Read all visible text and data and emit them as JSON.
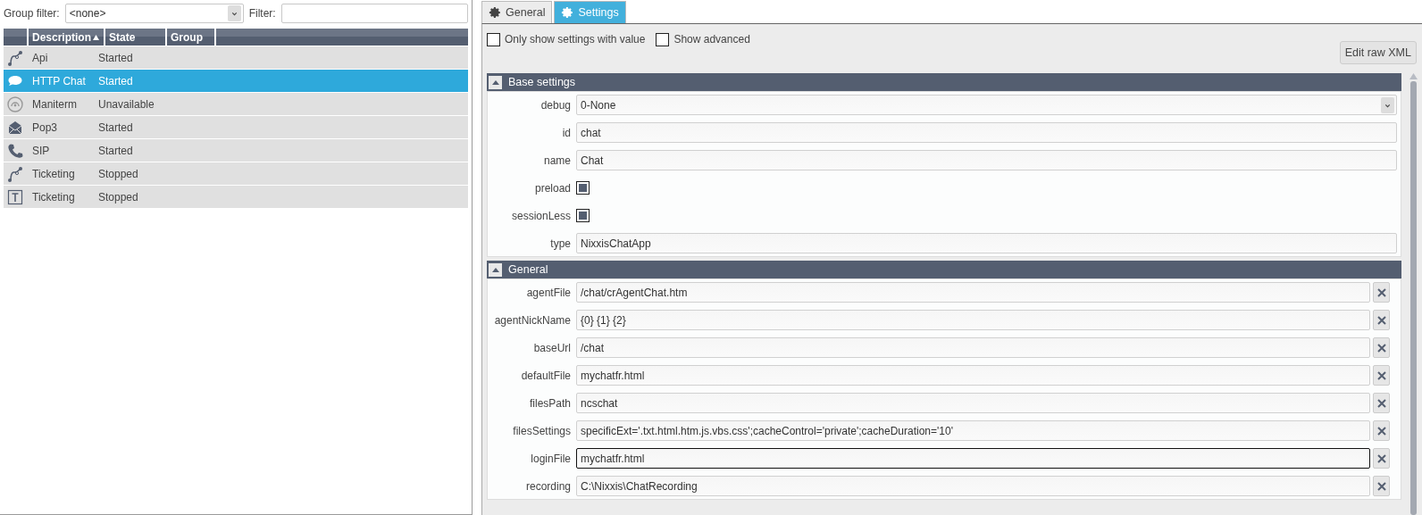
{
  "left": {
    "group_filter": {
      "label": "Group filter:",
      "value": "<none>"
    },
    "filter": {
      "label": "Filter:"
    },
    "columns": [
      {
        "sorted": false
      },
      {
        "label": "Description",
        "sorted": true
      },
      {
        "label": "State",
        "sorted": false
      },
      {
        "label": "Group",
        "sorted": false
      }
    ],
    "rows": [
      {
        "kind": "route",
        "description": "Api",
        "state": "Started",
        "selected": false
      },
      {
        "kind": "chat",
        "description": "HTTP Chat",
        "state": "Started",
        "selected": true
      },
      {
        "kind": "gauge",
        "description": "Maniterm",
        "state": "Unavailable",
        "selected": false
      },
      {
        "kind": "mail",
        "description": "Pop3",
        "state": "Started",
        "selected": false
      },
      {
        "kind": "phone",
        "description": "SIP",
        "state": "Started",
        "selected": false
      },
      {
        "kind": "route",
        "description": "Ticketing",
        "state": "Stopped",
        "selected": false
      },
      {
        "kind": "text",
        "description": "Ticketing",
        "state": "Stopped",
        "selected": false
      }
    ]
  },
  "tabs": [
    {
      "label": "General",
      "selected": false
    },
    {
      "label": "Settings",
      "selected": true
    }
  ],
  "options": [
    {
      "label": "Only show settings with value",
      "checked": false
    },
    {
      "label": "Show advanced",
      "checked": false
    }
  ],
  "edit_button": "Edit raw XML",
  "sections": [
    {
      "title": "Base settings",
      "expanded": true,
      "fields": [
        {
          "kind": "select",
          "label": "debug",
          "value": "0-None",
          "clearable": false,
          "focused": false
        },
        {
          "kind": "text",
          "label": "id",
          "value": "chat",
          "clearable": false,
          "focused": false
        },
        {
          "kind": "text",
          "label": "name",
          "value": "Chat",
          "clearable": false,
          "focused": false
        },
        {
          "kind": "checkbox",
          "label": "preload",
          "checked": true
        },
        {
          "kind": "checkbox",
          "label": "sessionLess",
          "checked": true
        },
        {
          "kind": "text",
          "label": "type",
          "value": "NixxisChatApp",
          "clearable": false,
          "focused": false
        }
      ]
    },
    {
      "title": "General",
      "expanded": true,
      "fields": [
        {
          "kind": "text",
          "label": "agentFile",
          "value": "/chat/crAgentChat.htm",
          "clearable": true,
          "focused": false
        },
        {
          "kind": "text",
          "label": "agentNickName",
          "value": "{0} {1} {2}",
          "clearable": true,
          "focused": false
        },
        {
          "kind": "text",
          "label": "baseUrl",
          "value": "/chat",
          "clearable": true,
          "focused": false
        },
        {
          "kind": "text",
          "label": "defaultFile",
          "value": "mychatfr.html",
          "clearable": true,
          "focused": false
        },
        {
          "kind": "text",
          "label": "filesPath",
          "value": "ncschat",
          "clearable": true,
          "focused": false
        },
        {
          "kind": "text",
          "label": "filesSettings",
          "value": "specificExt='.txt.html.htm.js.vbs.css';cacheControl='private';cacheDuration='10'",
          "clearable": true,
          "focused": false
        },
        {
          "kind": "text",
          "label": "loginFile",
          "value": "mychatfr.html",
          "clearable": true,
          "focused": true
        },
        {
          "kind": "text",
          "label": "recording",
          "value": "C:\\Nixxis\\ChatRecording",
          "clearable": true,
          "focused": false
        }
      ]
    }
  ]
}
